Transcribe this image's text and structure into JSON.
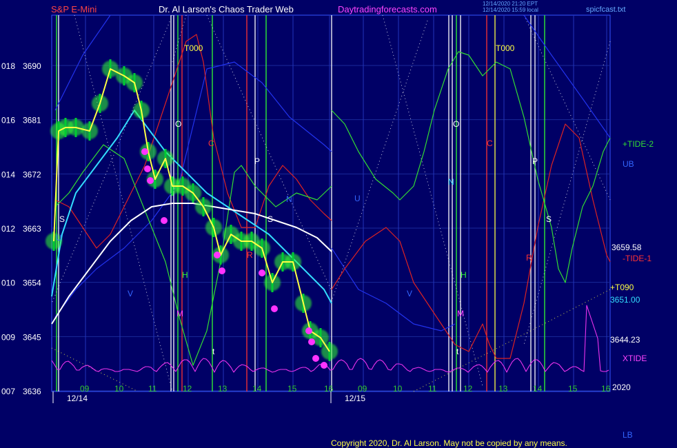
{
  "header": {
    "instrument": "S&P E-Mini",
    "site_title": "Dr. Al Larson's Chaos Trader Web",
    "site_url": "Daytradingforecasts.com",
    "timestamp_line1": "12/14/2020 21:20 EPT",
    "timestamp_line2": "12/14/2020 15:59 local",
    "filename": "spicfcast.txt"
  },
  "footer": {
    "copyright": "Copyright 2020, Dr. Al Larson. May not be copied by any means.",
    "lb_label": "LB"
  },
  "chart_data": {
    "type": "line",
    "title": "S&P E-Mini",
    "ylim": [
      3636,
      3696
    ],
    "y_ticks": [
      {
        "left": "018",
        "right": "3690",
        "value": 3690
      },
      {
        "left": "016",
        "right": "3681",
        "value": 3681
      },
      {
        "left": "014",
        "right": "3672",
        "value": 3672
      },
      {
        "left": "012",
        "right": "3663",
        "value": 3663
      },
      {
        "left": "010",
        "right": "3654",
        "value": 3654
      },
      {
        "left": "009",
        "right": "3645",
        "value": 3645
      },
      {
        "left": "007",
        "right": "3636",
        "value": 3636
      }
    ],
    "x_tick_labels": [
      "09",
      "10",
      "11",
      "12",
      "13",
      "14",
      "15",
      "16",
      "09",
      "10",
      "11",
      "12",
      "13",
      "14",
      "15",
      "16"
    ],
    "x_dates": [
      "12/14",
      "12/15"
    ],
    "right_labels": {
      "tide2": "+TIDE-2",
      "ub": "UB",
      "price_a": "3659.58",
      "tide1": "-TIDE-1",
      "t090": "+T090",
      "price_b": "3651.00",
      "price_c": "3644.23",
      "xtide": "XTIDE",
      "year": "2020"
    },
    "letter_markers": [
      "T000",
      "O",
      "C",
      "P",
      "S",
      "N",
      "H",
      "V",
      "M",
      "t",
      "R",
      "U",
      "T000",
      "O",
      "C",
      "P",
      "S",
      "N",
      "H",
      "V",
      "M",
      "t",
      "R"
    ],
    "colors": {
      "background": "#000066",
      "price_bar": "#00cc33",
      "glow": "#33ff33",
      "fast_avg": "#ffff44",
      "cyan_avg": "#33ddff",
      "white_avg": "#ffffff",
      "tide_plus2": "#33dd33",
      "tide_minus1": "#dd2222",
      "band_blue": "#2233ee",
      "xtide": "#ee33ee",
      "t090": "#ffff44",
      "flux_white": "#ffffff"
    },
    "series": [
      {
        "name": "S&P E-Mini",
        "values": [
          3650,
          3681,
          3682,
          3680,
          3681,
          3690,
          3688,
          3690,
          3684,
          3676,
          3675,
          3671,
          3669,
          3670,
          3668,
          3665,
          3662,
          3661,
          3659,
          3660,
          3661,
          3658,
          3651,
          3656,
          3654,
          3649,
          3645,
          3644,
          3642
        ]
      },
      {
        "name": "+TIDE-2"
      },
      {
        "name": "-TIDE-1"
      },
      {
        "name": "XTIDE"
      },
      {
        "name": "+T090"
      }
    ]
  }
}
